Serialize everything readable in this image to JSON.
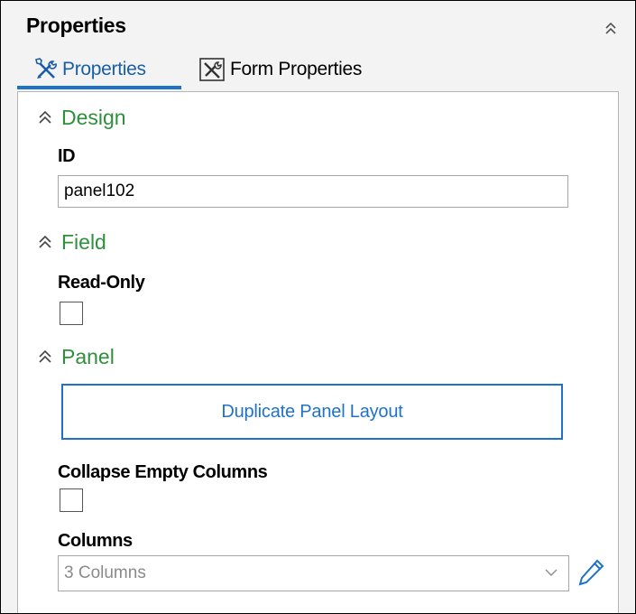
{
  "header": {
    "title": "Properties"
  },
  "tabs": [
    {
      "label": "Properties",
      "active": true,
      "icon": "tools-icon"
    },
    {
      "label": "Form Properties",
      "active": false,
      "icon": "form-tools-icon"
    }
  ],
  "sections": {
    "design": {
      "title": "Design",
      "id_label": "ID",
      "id_value": "panel102"
    },
    "field": {
      "title": "Field",
      "readonly_label": "Read-Only",
      "readonly_checked": false
    },
    "panel": {
      "title": "Panel",
      "duplicate_button": "Duplicate Panel Layout",
      "collapse_label": "Collapse Empty Columns",
      "collapse_checked": false,
      "columns_label": "Columns",
      "columns_value": "3 Columns"
    }
  },
  "colors": {
    "accent": "#1f72c9",
    "section_title": "#2e8f3d",
    "panel_bg": "#f3f3f3"
  }
}
